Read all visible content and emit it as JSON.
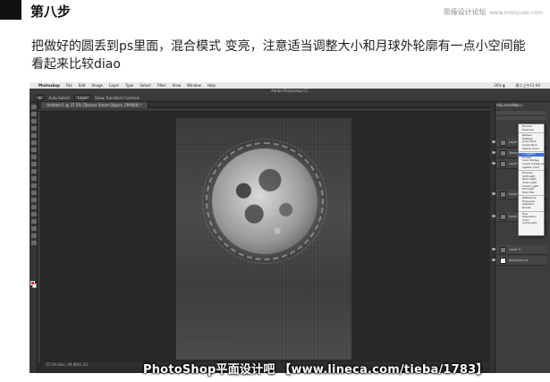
{
  "header": {
    "step": "第八步",
    "site": "思缘设计论坛",
    "site_url": "www.missyuan.com"
  },
  "description": "把做好的圆丢到ps里面，混合模式 变亮，注意适当调整大小和月球外轮廓有一点小空间能看起来比较diao",
  "photoshop": {
    "menubar": {
      "apple": "",
      "app": "Photoshop",
      "items": [
        "File",
        "Edit",
        "Image",
        "Layer",
        "Type",
        "Select",
        "Filter",
        "View",
        "Window",
        "Help"
      ],
      "right": [
        "36% ▮",
        "周二上午11:40"
      ]
    },
    "window_title": "Adobe Photoshop CC",
    "options": {
      "auto_select_label": "Auto-Select:",
      "auto_select_value": "Layer",
      "transform_label": "Show Transform Controls"
    },
    "doc_tab": "Untitled-1 @ 37.5% (Texture Smart Object, CMYK/8) *",
    "status_left": "37.5%",
    "status_doc": "Doc: 49.8M/1.5G",
    "panel": {
      "tab1": "Adjustments",
      "tab2": "Styles"
    },
    "blend_dropdown": {
      "groups": [
        [
          "Normal",
          "Dissolve"
        ],
        [
          "Darken",
          "Multiply",
          "Color Burn",
          "Linear Burn",
          "Darker Color"
        ],
        [
          "Lighten",
          "Screen",
          "Color Dodge",
          "Linear Dodge (Add)",
          "Lighter Color"
        ],
        [
          "Overlay",
          "Soft Light",
          "Hard Light",
          "Vivid Light",
          "Linear Light",
          "Pin Light",
          "Hard Mix"
        ],
        [
          "Difference",
          "Exclusion",
          "Subtract",
          "Divide"
        ],
        [
          "Hue",
          "Saturation",
          "Color",
          "Luminosity"
        ]
      ],
      "selected": "Lighten"
    },
    "layers": [
      "Layer 1",
      "Texture",
      "Layer 2",
      "Layer 3",
      "Layer 4",
      "Layer 5",
      "Background"
    ]
  },
  "watermark": "PhotoShop平面设计吧 【www.lineca.com/tieba/1783】",
  "colors": {
    "fg": "#e23030",
    "bg": "#ffffff",
    "accent": "#3b6fd6"
  }
}
